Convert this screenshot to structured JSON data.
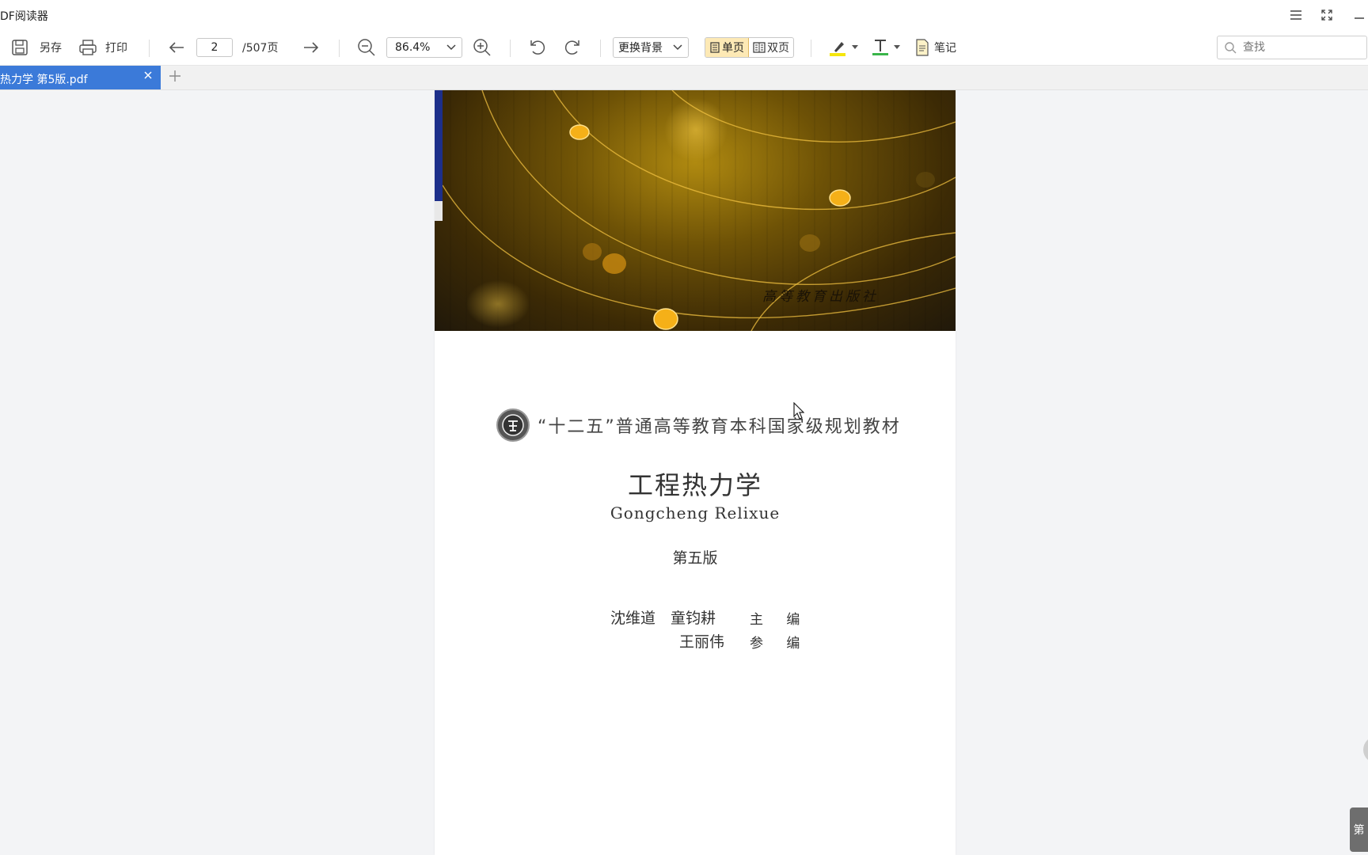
{
  "window": {
    "title": "DF阅读器",
    "menu_icon": "hamburger-menu-icon",
    "fullscreen_icon": "fullscreen-icon",
    "minimize_icon": "minimize-icon"
  },
  "toolbar": {
    "save_as_label": "另存",
    "print_label": "打印",
    "page_current": "2",
    "page_total": "/507页",
    "zoom_value": "86.4%",
    "background_label": "更换背景",
    "single_page_label": "单页",
    "double_page_label": "双页",
    "note_label": "笔记",
    "search_placeholder": "查找",
    "highlight_color": "#f5e60c",
    "text_color": "#39b54a"
  },
  "tabs": [
    {
      "title": "热力学  第5版.pdf",
      "active": true
    }
  ],
  "document": {
    "cover_publisher_seal": "高等教育出版社",
    "series": "“十二五”普通高等教育本科国家级规划教材",
    "title": "工程热力学",
    "title_pinyin": "Gongcheng Relixue",
    "edition": "第五版",
    "authors_main": "沈维道　童钧耕",
    "role_main": "主 编",
    "author_assist": "王丽伟",
    "role_assist": "参 编"
  },
  "side": {
    "page_tab_label": "第"
  }
}
